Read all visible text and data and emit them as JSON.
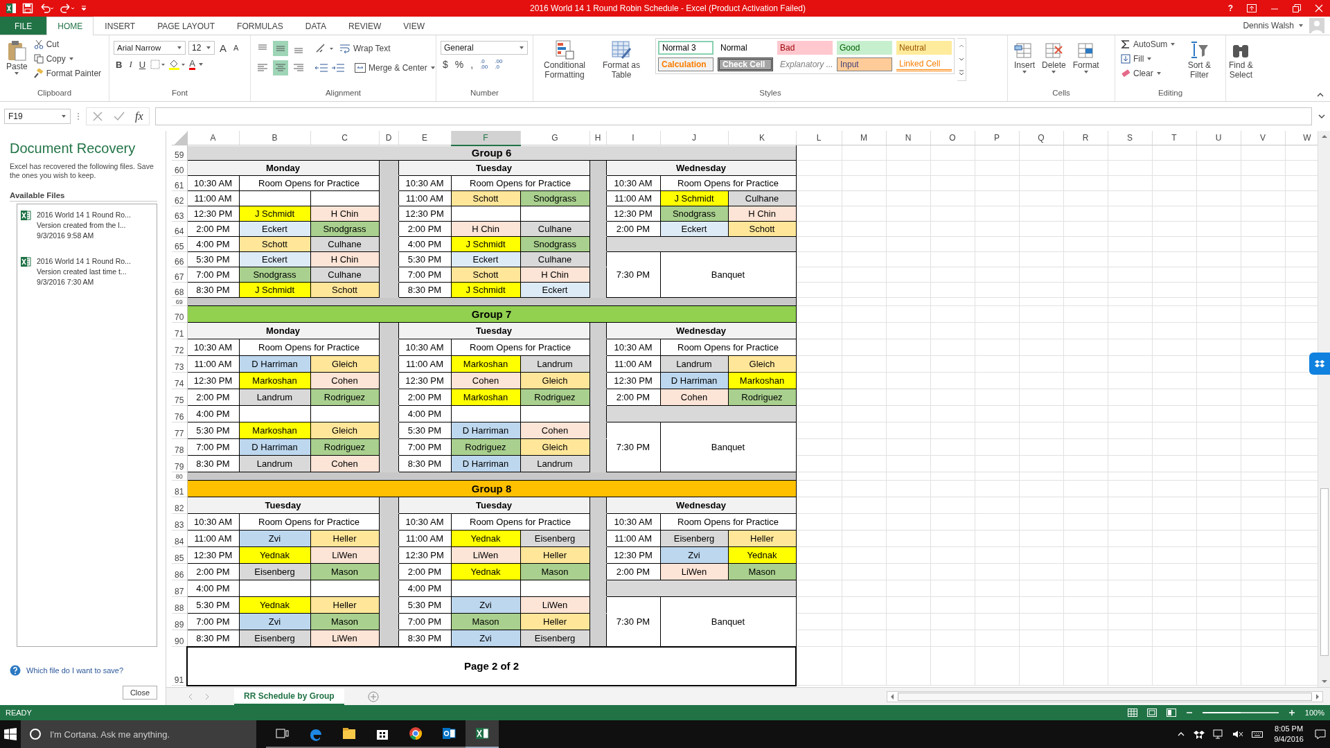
{
  "title_bar": {
    "title": "2016 World 14 1 Round Robin Schedule - Excel (Product Activation Failed)",
    "help": "?",
    "user": "Dennis Walsh"
  },
  "ribbon_tabs": [
    {
      "label": "FILE",
      "kind": "file",
      "selected": false
    },
    {
      "label": "HOME",
      "kind": "tab",
      "selected": true
    },
    {
      "label": "INSERT",
      "kind": "tab",
      "selected": false
    },
    {
      "label": "PAGE LAYOUT",
      "kind": "tab",
      "selected": false
    },
    {
      "label": "FORMULAS",
      "kind": "tab",
      "selected": false
    },
    {
      "label": "DATA",
      "kind": "tab",
      "selected": false
    },
    {
      "label": "REVIEW",
      "kind": "tab",
      "selected": false
    },
    {
      "label": "VIEW",
      "kind": "tab",
      "selected": false
    }
  ],
  "ribbon": {
    "groups": [
      {
        "kind": "clipboard",
        "label": "Clipboard",
        "paste": "Paste",
        "cut": "Cut",
        "copy": "Copy",
        "painter": "Format Painter"
      },
      {
        "kind": "font",
        "label": "Font",
        "font": "Arial Narrow",
        "size": "12",
        "grow": "A",
        "shrink": "A",
        "styles": [
          "B",
          "I",
          "U"
        ],
        "font_color": "A"
      },
      {
        "kind": "alignment",
        "label": "Alignment",
        "vertical": [
          {
            "kind": "top",
            "selected": false
          },
          {
            "kind": "middle",
            "selected": true
          },
          {
            "kind": "bottom",
            "selected": false
          }
        ],
        "horizontal": [
          {
            "kind": "left",
            "selected": false
          },
          {
            "kind": "center",
            "selected": true
          },
          {
            "kind": "right",
            "selected": false
          }
        ],
        "wrap": "Wrap Text",
        "merge": "Merge & Center"
      },
      {
        "kind": "number",
        "label": "Number",
        "format": "General",
        "symbols": [
          "$",
          "%",
          ","
        ],
        "decimals": [
          {
            "top": ".0",
            "bottom": ".00"
          },
          {
            "top": ".00",
            "bottom": ".0"
          }
        ]
      },
      {
        "kind": "styles",
        "label": "Styles",
        "conditional": "Conditional Formatting",
        "table": "Format as Table",
        "cell_styles": [
          {
            "label": "Normal 3",
            "kind": "normal3"
          },
          {
            "label": "Normal",
            "kind": "normal"
          },
          {
            "label": "Bad",
            "kind": "bad"
          },
          {
            "label": "Good",
            "kind": "good"
          },
          {
            "label": "Neutral",
            "kind": "neutral"
          },
          {
            "label": "Calculation",
            "kind": "calculation"
          },
          {
            "label": "Check Cell",
            "kind": "check"
          },
          {
            "label": "Explanatory ...",
            "kind": "explanatory"
          },
          {
            "label": "Input",
            "kind": "input"
          },
          {
            "label": "Linked Cell",
            "kind": "linked"
          }
        ]
      },
      {
        "kind": "cells",
        "label": "Cells",
        "buttons": [
          "Insert",
          "Delete",
          "Format"
        ]
      },
      {
        "kind": "editing",
        "label": "Editing",
        "autosum": "AutoSum",
        "fill": "Fill",
        "clear": "Clear",
        "sort": "Sort & Filter",
        "find": "Find & Select"
      }
    ]
  },
  "formula_bar": {
    "name_box": "F19",
    "function_label": "fx"
  },
  "recovery": {
    "title": "Document Recovery",
    "description": "Excel has recovered the following files. Save the ones you wish to keep.",
    "section": "Available Files",
    "files": [
      {
        "name": "2016 World 14 1 Round Ro...",
        "detail": "Version created from the l...",
        "date": "9/3/2016 9:58 AM"
      },
      {
        "name": "2016 World 14 1 Round Ro...",
        "detail": "Version created last time t...",
        "date": "9/3/2016 7:30 AM"
      }
    ],
    "help_link": "Which file do I want to save?",
    "close": "Close"
  },
  "sheet": {
    "columns": [
      {
        "label": "A",
        "selected": false
      },
      {
        "label": "B",
        "selected": false
      },
      {
        "label": "C",
        "selected": false
      },
      {
        "label": "D",
        "selected": false
      },
      {
        "label": "E",
        "selected": false
      },
      {
        "label": "F",
        "selected": true
      },
      {
        "label": "G",
        "selected": false
      },
      {
        "label": "H",
        "selected": false
      },
      {
        "label": "I",
        "selected": false
      },
      {
        "label": "J",
        "selected": false
      },
      {
        "label": "K",
        "selected": false
      },
      {
        "label": "L",
        "selected": false
      },
      {
        "label": "M",
        "selected": false
      },
      {
        "label": "N",
        "selected": false
      },
      {
        "label": "O",
        "selected": false
      },
      {
        "label": "P",
        "selected": false
      },
      {
        "label": "Q",
        "selected": false
      },
      {
        "label": "R",
        "selected": false
      },
      {
        "label": "S",
        "selected": false
      },
      {
        "label": "T",
        "selected": false
      },
      {
        "label": "U",
        "selected": false
      },
      {
        "label": "V",
        "selected": false
      },
      {
        "label": "W",
        "selected": false
      }
    ],
    "row_headers": [
      "59",
      "60",
      "61",
      "62",
      "63",
      "64",
      "65",
      "66",
      "67",
      "68",
      "69",
      "70",
      "71",
      "72",
      "73",
      "74",
      "75",
      "76",
      "77",
      "78",
      "79",
      "80",
      "81",
      "82",
      "83",
      "84",
      "85",
      "86",
      "87",
      "88",
      "89",
      "90",
      "91"
    ],
    "groups": [
      {
        "title": "Group 6",
        "color": "#d9d9d9",
        "days": [
          {
            "day": "Monday",
            "slots": [
              {
                "kind": "span",
                "time": "10:30 AM",
                "text": "Room Opens for Practice"
              },
              {
                "kind": "open",
                "time": "11:00 AM"
              },
              {
                "kind": "pair",
                "time": "12:30 PM",
                "a": {
                  "name": "J Schmidt",
                  "color": "#ffff00"
                },
                "b": {
                  "name": "H Chin",
                  "color": "#fce4d6"
                }
              },
              {
                "kind": "pair",
                "time": "2:00 PM",
                "a": {
                  "name": "Eckert",
                  "color": "#ddebf7"
                },
                "b": {
                  "name": "Snodgrass",
                  "color": "#a9d08e"
                }
              },
              {
                "kind": "pair",
                "time": "4:00 PM",
                "a": {
                  "name": "Schott",
                  "color": "#ffe699"
                },
                "b": {
                  "name": "Culhane",
                  "color": "#d9d9d9"
                }
              },
              {
                "kind": "pair",
                "time": "5:30 PM",
                "a": {
                  "name": "Eckert",
                  "color": "#ddebf7"
                },
                "b": {
                  "name": "H Chin",
                  "color": "#fce4d6"
                }
              },
              {
                "kind": "pair",
                "time": "7:00 PM",
                "a": {
                  "name": "Snodgrass",
                  "color": "#a9d08e"
                },
                "b": {
                  "name": "Culhane",
                  "color": "#d9d9d9"
                }
              },
              {
                "kind": "pair",
                "time": "8:30 PM",
                "a": {
                  "name": "J Schmidt",
                  "color": "#ffff00"
                },
                "b": {
                  "name": "Schott",
                  "color": "#ffe699"
                }
              }
            ]
          },
          {
            "day": "Tuesday",
            "slots": [
              {
                "kind": "span",
                "time": "10:30 AM",
                "text": "Room Opens for Practice"
              },
              {
                "kind": "pair",
                "time": "11:00 AM",
                "a": {
                  "name": "Schott",
                  "color": "#ffe699"
                },
                "b": {
                  "name": "Snodgrass",
                  "color": "#a9d08e"
                }
              },
              {
                "kind": "open",
                "time": "12:30 PM"
              },
              {
                "kind": "pair",
                "time": "2:00 PM",
                "a": {
                  "name": "H Chin",
                  "color": "#fce4d6"
                },
                "b": {
                  "name": "Culhane",
                  "color": "#d9d9d9"
                }
              },
              {
                "kind": "pair",
                "time": "4:00 PM",
                "a": {
                  "name": "J Schmidt",
                  "color": "#ffff00"
                },
                "b": {
                  "name": "Snodgrass",
                  "color": "#a9d08e"
                }
              },
              {
                "kind": "pair",
                "time": "5:30 PM",
                "a": {
                  "name": "Eckert",
                  "color": "#ddebf7"
                },
                "b": {
                  "name": "Culhane",
                  "color": "#d9d9d9"
                }
              },
              {
                "kind": "pair",
                "time": "7:00 PM",
                "a": {
                  "name": "Schott",
                  "color": "#ffe699"
                },
                "b": {
                  "name": "H Chin",
                  "color": "#fce4d6"
                }
              },
              {
                "kind": "pair",
                "time": "8:30 PM",
                "a": {
                  "name": "J Schmidt",
                  "color": "#ffff00"
                },
                "b": {
                  "name": "Eckert",
                  "color": "#ddebf7"
                }
              }
            ]
          },
          {
            "day": "Wednesday",
            "slots": [
              {
                "kind": "span",
                "time": "10:30 AM",
                "text": "Room Opens for Practice"
              },
              {
                "kind": "pair",
                "time": "11:00 AM",
                "a": {
                  "name": "J Schmidt",
                  "color": "#ffff00"
                },
                "b": {
                  "name": "Culhane",
                  "color": "#d9d9d9"
                }
              },
              {
                "kind": "pair",
                "time": "12:30 PM",
                "a": {
                  "name": "Snodgrass",
                  "color": "#a9d08e"
                },
                "b": {
                  "name": "H Chin",
                  "color": "#fce4d6"
                }
              },
              {
                "kind": "pair",
                "time": "2:00 PM",
                "a": {
                  "name": "Eckert",
                  "color": "#ddebf7"
                },
                "b": {
                  "name": "Schott",
                  "color": "#ffe699"
                }
              },
              {
                "kind": "break"
              },
              {
                "kind": "banquet",
                "time": "7:30 PM",
                "text": "Banquet"
              }
            ]
          }
        ]
      },
      {
        "title": "Group 7",
        "color": "#92d050",
        "days": [
          {
            "day": "Monday",
            "slots": [
              {
                "kind": "span",
                "time": "10:30 AM",
                "text": "Room Opens for Practice"
              },
              {
                "kind": "pair",
                "time": "11:00 AM",
                "a": {
                  "name": "D Harriman",
                  "color": "#bdd7ee"
                },
                "b": {
                  "name": "Gleich",
                  "color": "#ffe699"
                }
              },
              {
                "kind": "pair",
                "time": "12:30 PM",
                "a": {
                  "name": "Markoshan",
                  "color": "#ffff00"
                },
                "b": {
                  "name": "Cohen",
                  "color": "#fce4d6"
                }
              },
              {
                "kind": "pair",
                "time": "2:00 PM",
                "a": {
                  "name": "Landrum",
                  "color": "#d9d9d9"
                },
                "b": {
                  "name": "Rodriguez",
                  "color": "#a9d08e"
                }
              },
              {
                "kind": "open",
                "time": "4:00 PM"
              },
              {
                "kind": "pair",
                "time": "5:30 PM",
                "a": {
                  "name": "Markoshan",
                  "color": "#ffff00"
                },
                "b": {
                  "name": "Gleich",
                  "color": "#ffe699"
                }
              },
              {
                "kind": "pair",
                "time": "7:00 PM",
                "a": {
                  "name": "D Harriman",
                  "color": "#bdd7ee"
                },
                "b": {
                  "name": "Rodriguez",
                  "color": "#a9d08e"
                }
              },
              {
                "kind": "pair",
                "time": "8:30 PM",
                "a": {
                  "name": "Landrum",
                  "color": "#d9d9d9"
                },
                "b": {
                  "name": "Cohen",
                  "color": "#fce4d6"
                }
              }
            ]
          },
          {
            "day": "Tuesday",
            "slots": [
              {
                "kind": "span",
                "time": "10:30 AM",
                "text": "Room Opens for Practice"
              },
              {
                "kind": "pair",
                "time": "11:00 AM",
                "a": {
                  "name": "Markoshan",
                  "color": "#ffff00"
                },
                "b": {
                  "name": "Landrum",
                  "color": "#d9d9d9"
                }
              },
              {
                "kind": "pair",
                "time": "12:30 PM",
                "a": {
                  "name": "Cohen",
                  "color": "#fce4d6"
                },
                "b": {
                  "name": "Gleich",
                  "color": "#ffe699"
                }
              },
              {
                "kind": "pair",
                "time": "2:00 PM",
                "a": {
                  "name": "Markoshan",
                  "color": "#ffff00"
                },
                "b": {
                  "name": "Rodriguez",
                  "color": "#a9d08e"
                }
              },
              {
                "kind": "open",
                "time": "4:00 PM"
              },
              {
                "kind": "pair",
                "time": "5:30 PM",
                "a": {
                  "name": "D Harriman",
                  "color": "#bdd7ee"
                },
                "b": {
                  "name": "Cohen",
                  "color": "#fce4d6"
                }
              },
              {
                "kind": "pair",
                "time": "7:00 PM",
                "a": {
                  "name": "Rodriguez",
                  "color": "#a9d08e"
                },
                "b": {
                  "name": "Gleich",
                  "color": "#ffe699"
                }
              },
              {
                "kind": "pair",
                "time": "8:30 PM",
                "a": {
                  "name": "D Harriman",
                  "color": "#bdd7ee"
                },
                "b": {
                  "name": "Landrum",
                  "color": "#d9d9d9"
                }
              }
            ]
          },
          {
            "day": "Wednesday",
            "slots": [
              {
                "kind": "span",
                "time": "10:30 AM",
                "text": "Room Opens for Practice"
              },
              {
                "kind": "pair",
                "time": "11:00 AM",
                "a": {
                  "name": "Landrum",
                  "color": "#d9d9d9"
                },
                "b": {
                  "name": "Gleich",
                  "color": "#ffe699"
                }
              },
              {
                "kind": "pair",
                "time": "12:30 PM",
                "a": {
                  "name": "D Harriman",
                  "color": "#bdd7ee"
                },
                "b": {
                  "name": "Markoshan",
                  "color": "#ffff00"
                }
              },
              {
                "kind": "pair",
                "time": "2:00 PM",
                "a": {
                  "name": "Cohen",
                  "color": "#fce4d6"
                },
                "b": {
                  "name": "Rodriguez",
                  "color": "#a9d08e"
                }
              },
              {
                "kind": "break"
              },
              {
                "kind": "banquet",
                "time": "7:30 PM",
                "text": "Banquet"
              }
            ]
          }
        ]
      },
      {
        "title": "Group 8",
        "color": "#ffc000",
        "days": [
          {
            "day": "Tuesday",
            "slots": [
              {
                "kind": "span",
                "time": "10:30 AM",
                "text": "Room Opens for Practice"
              },
              {
                "kind": "pair",
                "time": "11:00 AM",
                "a": {
                  "name": "Zvi",
                  "color": "#bdd7ee"
                },
                "b": {
                  "name": "Heller",
                  "color": "#ffe699"
                }
              },
              {
                "kind": "pair",
                "time": "12:30 PM",
                "a": {
                  "name": "Yednak",
                  "color": "#ffff00"
                },
                "b": {
                  "name": "LiWen",
                  "color": "#fce4d6"
                }
              },
              {
                "kind": "pair",
                "time": "2:00 PM",
                "a": {
                  "name": "Eisenberg",
                  "color": "#d9d9d9"
                },
                "b": {
                  "name": "Mason",
                  "color": "#a9d08e"
                }
              },
              {
                "kind": "open",
                "time": "4:00 PM"
              },
              {
                "kind": "pair",
                "time": "5:30 PM",
                "a": {
                  "name": "Yednak",
                  "color": "#ffff00"
                },
                "b": {
                  "name": "Heller",
                  "color": "#ffe699"
                }
              },
              {
                "kind": "pair",
                "time": "7:00 PM",
                "a": {
                  "name": "Zvi",
                  "color": "#bdd7ee"
                },
                "b": {
                  "name": "Mason",
                  "color": "#a9d08e"
                }
              },
              {
                "kind": "pair",
                "time": "8:30 PM",
                "a": {
                  "name": "Eisenberg",
                  "color": "#d9d9d9"
                },
                "b": {
                  "name": "LiWen",
                  "color": "#fce4d6"
                }
              }
            ]
          },
          {
            "day": "Tuesday",
            "slots": [
              {
                "kind": "span",
                "time": "10:30 AM",
                "text": "Room Opens for Practice"
              },
              {
                "kind": "pair",
                "time": "11:00 AM",
                "a": {
                  "name": "Yednak",
                  "color": "#ffff00"
                },
                "b": {
                  "name": "Eisenberg",
                  "color": "#d9d9d9"
                }
              },
              {
                "kind": "pair",
                "time": "12:30 PM",
                "a": {
                  "name": "LiWen",
                  "color": "#fce4d6"
                },
                "b": {
                  "name": "Heller",
                  "color": "#ffe699"
                }
              },
              {
                "kind": "pair",
                "time": "2:00 PM",
                "a": {
                  "name": "Yednak",
                  "color": "#ffff00"
                },
                "b": {
                  "name": "Mason",
                  "color": "#a9d08e"
                }
              },
              {
                "kind": "open",
                "time": "4:00 PM"
              },
              {
                "kind": "pair",
                "time": "5:30 PM",
                "a": {
                  "name": "Zvi",
                  "color": "#bdd7ee"
                },
                "b": {
                  "name": "LiWen",
                  "color": "#fce4d6"
                }
              },
              {
                "kind": "pair",
                "time": "7:00 PM",
                "a": {
                  "name": "Mason",
                  "color": "#a9d08e"
                },
                "b": {
                  "name": "Heller",
                  "color": "#ffe699"
                }
              },
              {
                "kind": "pair",
                "time": "8:30 PM",
                "a": {
                  "name": "Zvi",
                  "color": "#bdd7ee"
                },
                "b": {
                  "name": "Eisenberg",
                  "color": "#d9d9d9"
                }
              }
            ]
          },
          {
            "day": "Wednesday",
            "slots": [
              {
                "kind": "span",
                "time": "10:30 AM",
                "text": "Room Opens for Practice"
              },
              {
                "kind": "pair",
                "time": "11:00 AM",
                "a": {
                  "name": "Eisenberg",
                  "color": "#d9d9d9"
                },
                "b": {
                  "name": "Heller",
                  "color": "#ffe699"
                }
              },
              {
                "kind": "pair",
                "time": "12:30 PM",
                "a": {
                  "name": "Zvi",
                  "color": "#bdd7ee"
                },
                "b": {
                  "name": "Yednak",
                  "color": "#ffff00"
                }
              },
              {
                "kind": "pair",
                "time": "2:00 PM",
                "a": {
                  "name": "LiWen",
                  "color": "#fce4d6"
                },
                "b": {
                  "name": "Mason",
                  "color": "#a9d08e"
                }
              },
              {
                "kind": "break"
              },
              {
                "kind": "banquet",
                "time": "7:30 PM",
                "text": "Banquet"
              }
            ]
          }
        ]
      }
    ],
    "page_label": "Page 2 of 2"
  },
  "sheet_tabs": [
    {
      "label": "RR Schedule by Group",
      "selected": true
    }
  ],
  "status_bar": {
    "status": "READY",
    "zoom": {
      "level": 0.5,
      "reading": "100%"
    }
  },
  "taskbar": {
    "search_placeholder": "I'm Cortana. Ask me anything.",
    "apps": [
      {
        "kind": "taskview",
        "selected": false
      },
      {
        "kind": "edge",
        "selected": false
      },
      {
        "kind": "explorer",
        "selected": false
      },
      {
        "kind": "store",
        "selected": false
      },
      {
        "kind": "chrome",
        "selected": false
      },
      {
        "kind": "outlook",
        "selected": false
      },
      {
        "kind": "excel",
        "selected": true
      }
    ],
    "time": "8:05 PM",
    "date": "9/4/2016"
  }
}
